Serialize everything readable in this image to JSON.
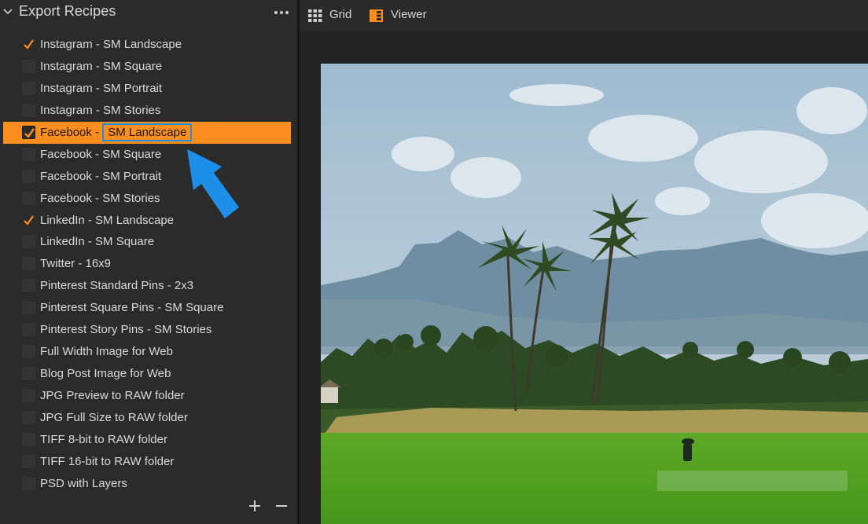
{
  "panel": {
    "title": "Export Recipes",
    "more_icon": "more-horizontal-icon",
    "collapse_icon": "chevron-down-icon"
  },
  "recipes": [
    {
      "label": "Instagram - SM Landscape",
      "checked": true
    },
    {
      "label": "Instagram - SM Square",
      "checked": false
    },
    {
      "label": "Instagram - SM Portrait",
      "checked": false
    },
    {
      "label": "Instagram - SM Stories",
      "checked": false
    },
    {
      "label_prefix": "Facebook - ",
      "label_highlight": "SM Landscape",
      "checked": true,
      "selected": true
    },
    {
      "label": "Facebook - SM Square",
      "checked": false
    },
    {
      "label": "Facebook - SM Portrait",
      "checked": false
    },
    {
      "label": "Facebook - SM Stories",
      "checked": false
    },
    {
      "label": "LinkedIn - SM Landscape",
      "checked": true
    },
    {
      "label": "LinkedIn - SM Square",
      "checked": false
    },
    {
      "label": "Twitter - 16x9",
      "checked": false
    },
    {
      "label": "Pinterest Standard Pins - 2x3",
      "checked": false
    },
    {
      "label": "Pinterest Square Pins - SM Square",
      "checked": false
    },
    {
      "label": "Pinterest Story Pins - SM Stories",
      "checked": false
    },
    {
      "label": "Full Width Image for Web",
      "checked": false
    },
    {
      "label": "Blog Post Image for Web",
      "checked": false
    },
    {
      "label": "JPG Preview to RAW folder",
      "checked": false
    },
    {
      "label": "JPG Full Size to RAW folder",
      "checked": false
    },
    {
      "label": "TIFF 8-bit to RAW folder",
      "checked": false
    },
    {
      "label": "TIFF 16-bit to RAW folder",
      "checked": false
    },
    {
      "label": "PSD with Layers",
      "checked": false
    }
  ],
  "footer": {
    "add_icon": "plus-icon",
    "remove_icon": "minus-icon"
  },
  "toolbar": {
    "grid_label": "Grid",
    "viewer_label": "Viewer",
    "grid_icon": "grid-icon",
    "viewer_icon": "viewer-icon"
  },
  "colors": {
    "accent": "#fb8e1e",
    "highlight_border": "#1b8fe0",
    "annotation_arrow": "#1e8fe8",
    "panel_bg": "#2b2b2b"
  },
  "viewer": {
    "image": "landscape-photo",
    "scene": "rice field with palm trees and mountains"
  }
}
